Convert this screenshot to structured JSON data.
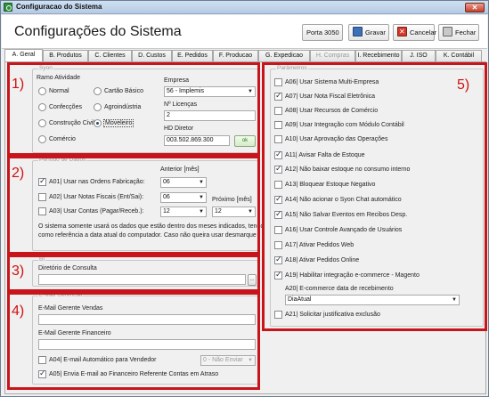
{
  "window": {
    "title": "Configuracao do Sistema",
    "close_glyph": "✕"
  },
  "header": {
    "page_title": "Configurações do Sistema",
    "btn_porta": "Porta 3050",
    "btn_gravar": "Gravar",
    "btn_cancelar": "Cancelar",
    "btn_fechar": "Fechar"
  },
  "tabs": [
    {
      "label": "A. Geral",
      "active": true
    },
    {
      "label": "B. Produtos"
    },
    {
      "label": "C. Clientes"
    },
    {
      "label": "D. Custos"
    },
    {
      "label": "E. Pedidos"
    },
    {
      "label": "F. Producao"
    },
    {
      "label": "G. Expedicao"
    },
    {
      "label": "H. Compras",
      "disabled": true
    },
    {
      "label": "I. Recebimento"
    },
    {
      "label": "J. ISO"
    },
    {
      "label": "K. Contábil"
    }
  ],
  "annotations": {
    "s1": "1)",
    "s2": "2)",
    "s3": "3)",
    "s4": "4)",
    "s5": "5)"
  },
  "syon": {
    "legend": "Syon",
    "ramo_label": "Ramo Atividade",
    "ramos": [
      "Normal",
      "Cartão Básico",
      "Confecções",
      "Agroindústria",
      "Construção Civil",
      "Moveleiro",
      "Comércio"
    ],
    "selected": "Moveleiro",
    "empresa_label": "Empresa",
    "empresa_value": "56 - Implemis",
    "licencas_label": "Nº Licenças",
    "licencas_value": "2",
    "hd_label": "HD Diretor",
    "hd_value": "003.502.869.300",
    "ok_label": "ok"
  },
  "periodo": {
    "legend": "Período de Dados",
    "anterior_label": "Anterior [mês]",
    "proximo_label": "Próximo [mês]",
    "a01_label": "A01| Usar nas Ordens Fabricação:",
    "a01_value": "06",
    "a02_label": "A02| Usar Notas Fiscais (Ent/Sai):",
    "a02_value": "06",
    "a03_label": "A03| Usar Contas (Pagar/Receb.):",
    "a03_anterior": "12",
    "a03_proximo": "12",
    "info_line1": "O sistema somente usará os dados que estão dentro dos meses indicados, tendo",
    "info_line2": "como referência a data atual do computador. Caso não queira usar desmarque"
  },
  "bi": {
    "legend": "BI",
    "diretorio_label": "Diretório de Consulta",
    "browse_label": "..."
  },
  "email": {
    "legend": "E-Mail Gerencial",
    "vendas_label": "E-Mail Gerente Vendas",
    "financeiro_label": "E-Mail Gerente Financeiro",
    "a04_label": "A04| E-mail Automático para Vendedor",
    "a04_value": "0 - Não Enviar",
    "a05_label": "A05| Envia E-mail ao Financeiro Referente Contas em Atraso"
  },
  "parametros": {
    "legend": "Parâmetros",
    "items": [
      {
        "label": "A06| Usar Sistema Multi-Empresa",
        "checked": false
      },
      {
        "label": "A07| Usar Nota Fiscal Eletrônica",
        "checked": true
      },
      {
        "label": "A08| Usar Recursos de Comércio",
        "checked": false
      },
      {
        "label": "A09| Usar Integração com Módulo Contábil",
        "checked": false
      },
      {
        "label": "A10| Usar Aprovação das Operações",
        "checked": false
      },
      {
        "label": "A11| Avisar Falta de Estoque",
        "checked": true
      },
      {
        "label": "A12| Não baixar estoque no consumo interno",
        "checked": true
      },
      {
        "label": "A13| Bloquear Estoque Negativo",
        "checked": false
      },
      {
        "label": "A14| Não acionar o Syon Chat automático",
        "checked": true
      },
      {
        "label": "A15| Não Salvar Eventos em Recibos Desp.",
        "checked": true
      },
      {
        "label": "A16| Usar Controle Avançado de Usuários",
        "checked": false
      },
      {
        "label": "A17| Ativar Pedidos Web",
        "checked": false
      },
      {
        "label": "A18| Ativar Pedidos Online",
        "checked": true
      },
      {
        "label": "A19| Habilitar integração e-commerce - Magento",
        "checked": true
      }
    ],
    "a20_label": "A20| E-commerce data de recebimento",
    "a20_value": "DiaAtual",
    "a21_label": "A21| Solicitar justificativa exclusão",
    "a21_checked": false
  }
}
